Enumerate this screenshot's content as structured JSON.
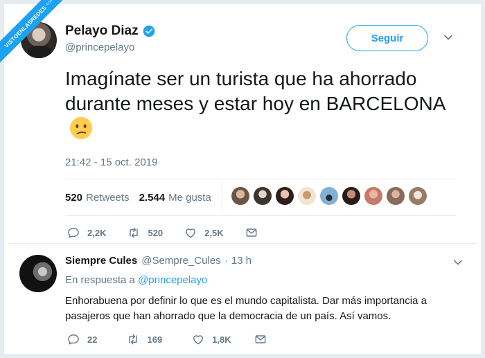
{
  "watermark": {
    "text": "VISTOENLASREDES",
    "suffix": ".com"
  },
  "tweet": {
    "author_name": "Pelayo Diaz",
    "author_handle": "@princepelayo",
    "follow_label": "Seguir",
    "text": "Imagínate ser un turista que ha ahorrado durante meses y estar hoy en BARCELONA",
    "emoji": "confused-face",
    "timestamp": "21:42 - 15 oct. 2019",
    "retweets_count": "520",
    "retweets_label": "Retweets",
    "likes_count": "2.544",
    "likes_label": "Me gusta",
    "actions": {
      "replies": "2,2K",
      "retweets": "520",
      "likes": "2,5K"
    }
  },
  "reply": {
    "author_name": "Siempre Cules",
    "author_handle": "@Sempre_Cules",
    "time": "· 13 h",
    "in_reply_prefix": "En respuesta a",
    "in_reply_mention": "@princepelayo",
    "text": "Enhorabuena por definir lo que es el mundo capitalista. Dar más importancia a pasajeros que han ahorrado que la democracia de un país. Así vamos.",
    "actions": {
      "replies": "22",
      "retweets": "169",
      "likes": "1,8K"
    }
  },
  "colors": {
    "accent": "#1da1f2",
    "secondary_text": "#657786",
    "border": "#e6ecf0"
  }
}
